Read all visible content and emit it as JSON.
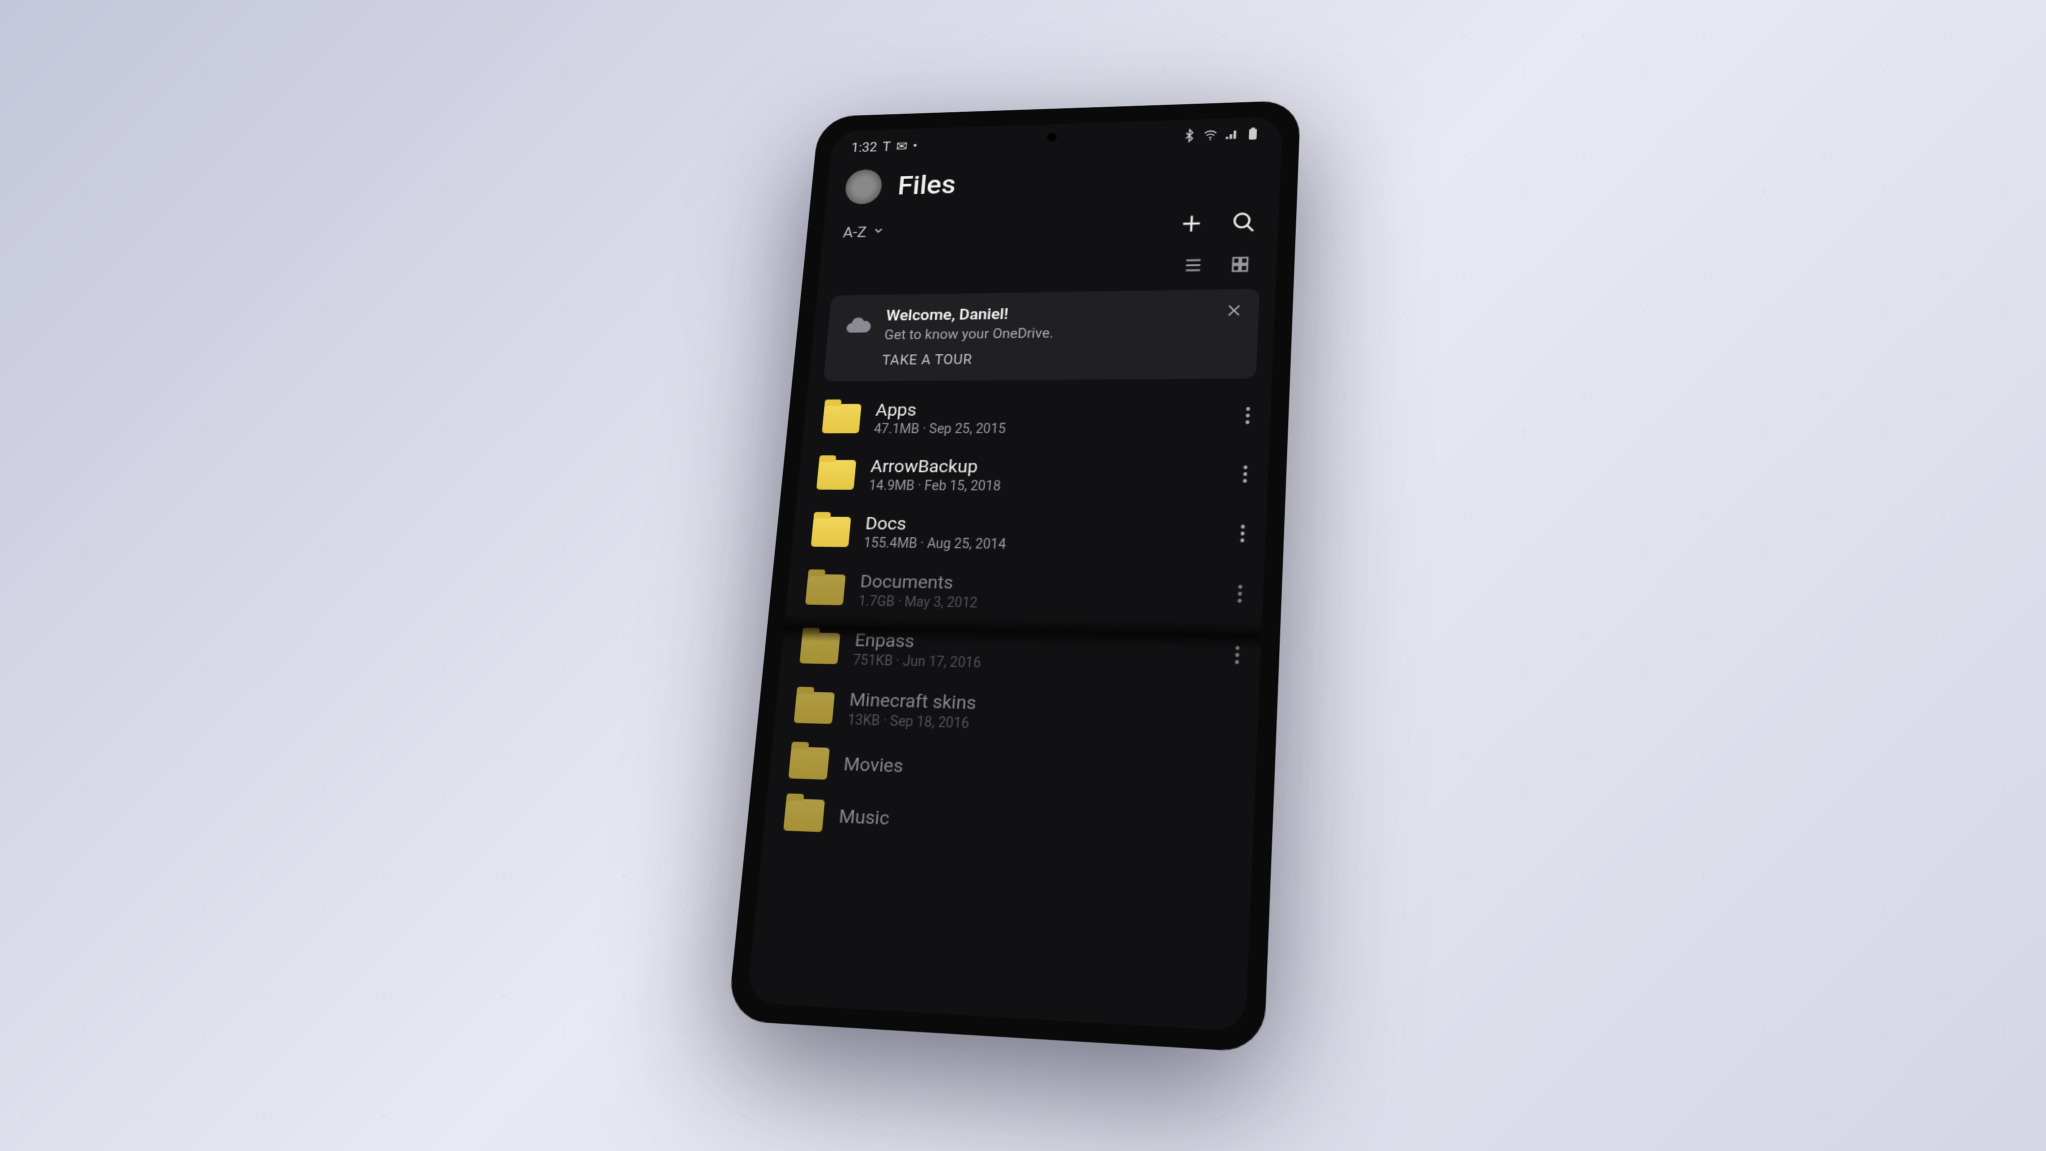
{
  "statusBar": {
    "time": "1:32",
    "carrierLetter": "T"
  },
  "header": {
    "title": "Files"
  },
  "toolbar": {
    "sortLabel": "A-Z"
  },
  "welcome": {
    "title": "Welcome, Daniel!",
    "subtitle": "Get to know your OneDrive.",
    "cta": "TAKE A TOUR"
  },
  "folders": [
    {
      "name": "Apps",
      "size": "47.1MB",
      "date": "Sep 25, 2015"
    },
    {
      "name": "ArrowBackup",
      "size": "14.9MB",
      "date": "Feb 15, 2018"
    },
    {
      "name": "Docs",
      "size": "155.4MB",
      "date": "Aug 25, 2014"
    },
    {
      "name": "Documents",
      "size": "1.7GB",
      "date": "May 3, 2012"
    },
    {
      "name": "Enpass",
      "size": "751KB",
      "date": "Jun 17, 2016"
    },
    {
      "name": "Minecraft skins",
      "size": "13KB",
      "date": "Sep 18, 2016"
    },
    {
      "name": "Movies",
      "size": "",
      "date": ""
    },
    {
      "name": "Music",
      "size": "",
      "date": ""
    }
  ]
}
